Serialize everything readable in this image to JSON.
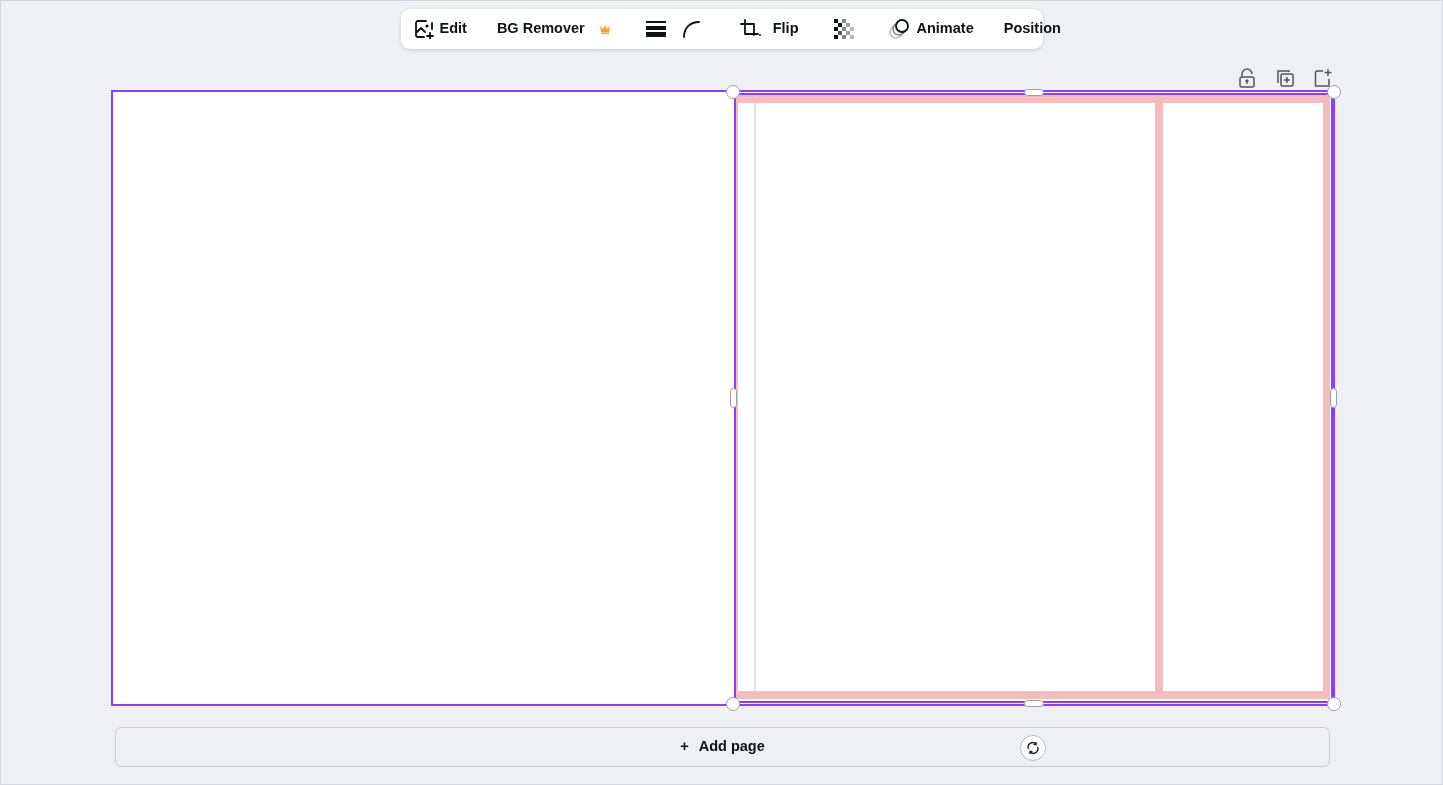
{
  "toolbar": [
    {
      "kind": "button",
      "label": "Edit"
    },
    {
      "kind": "divider"
    },
    {
      "kind": "button",
      "label": "BG Remover",
      "premium": true
    },
    {
      "kind": "divider"
    },
    {
      "kind": "icon"
    },
    {
      "kind": "icon"
    },
    {
      "kind": "divider"
    },
    {
      "kind": "icon"
    },
    {
      "kind": "button",
      "label": "Flip"
    },
    {
      "kind": "divider"
    },
    {
      "kind": "icon"
    },
    {
      "kind": "divider"
    },
    {
      "kind": "button",
      "label": "Animate"
    },
    {
      "kind": "divider"
    },
    {
      "kind": "button",
      "label": "Position"
    }
  ],
  "canvas": {
    "frame": {
      "selected": true
    }
  },
  "add_page": {
    "symbol": "+",
    "label": "Add page"
  }
}
